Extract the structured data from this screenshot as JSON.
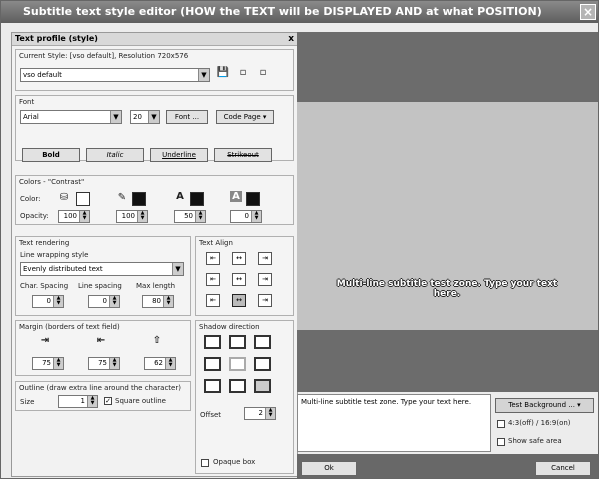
{
  "window": {
    "title": "Subtitle text style editor  (HOW the TEXT will be DISPLAYED AND at what POSITION)",
    "close_glyph": "×"
  },
  "profile": {
    "header": "Text profile (style)",
    "close_glyph": "x",
    "current_style_label": "Current Style: [vso default], Resolution 720x576",
    "style_value": "vso default"
  },
  "font": {
    "group_label": "Font",
    "family": "Arial",
    "size": "20",
    "font_button": "Font ...",
    "codepage_button": "Code Page",
    "bold": "Bold",
    "italic": "Italic",
    "underline": "Underline",
    "strikeout": "Strikeout"
  },
  "colors": {
    "group_label": "Colors - \"Contrast\"",
    "color_label": "Color:",
    "opacity_label": "Opacity:",
    "opacities": [
      "100",
      "100",
      "50",
      "0"
    ],
    "text_icon_glyph": "A",
    "text_icon_2_glyph": "A"
  },
  "rendering": {
    "group_label": "Text rendering",
    "wrap_label": "Line wrapping style",
    "wrap_value": "Evenly distributed text",
    "char_spacing_label": "Char. Spacing",
    "char_spacing": "0",
    "line_spacing_label": "Line spacing",
    "line_spacing": "0",
    "max_length_label": "Max length",
    "max_length": "80"
  },
  "align": {
    "group_label": "Text Align"
  },
  "margin": {
    "group_label": "Margin  (borders of text field)",
    "values": [
      "75",
      "75",
      "62"
    ]
  },
  "shadow": {
    "group_label": "Shadow direction",
    "offset_label": "Offset",
    "offset": "2",
    "opaque_label": "Opaque box"
  },
  "outline": {
    "group_label": "Outline  (draw extra line around the character)",
    "size_label": "Size",
    "size": "1",
    "square_label": "Square outline"
  },
  "preview": {
    "text": "Multi-line subtitle test zone. Type your text here.",
    "input_text": "Multi-line subtitle test zone. Type your text here.",
    "bg_button": "Test Background ...",
    "ratio_label": "4:3(off) / 16:9(on)",
    "safe_label": "Show safe area"
  },
  "buttons": {
    "ok": "Ok",
    "cancel": "Cancel"
  }
}
